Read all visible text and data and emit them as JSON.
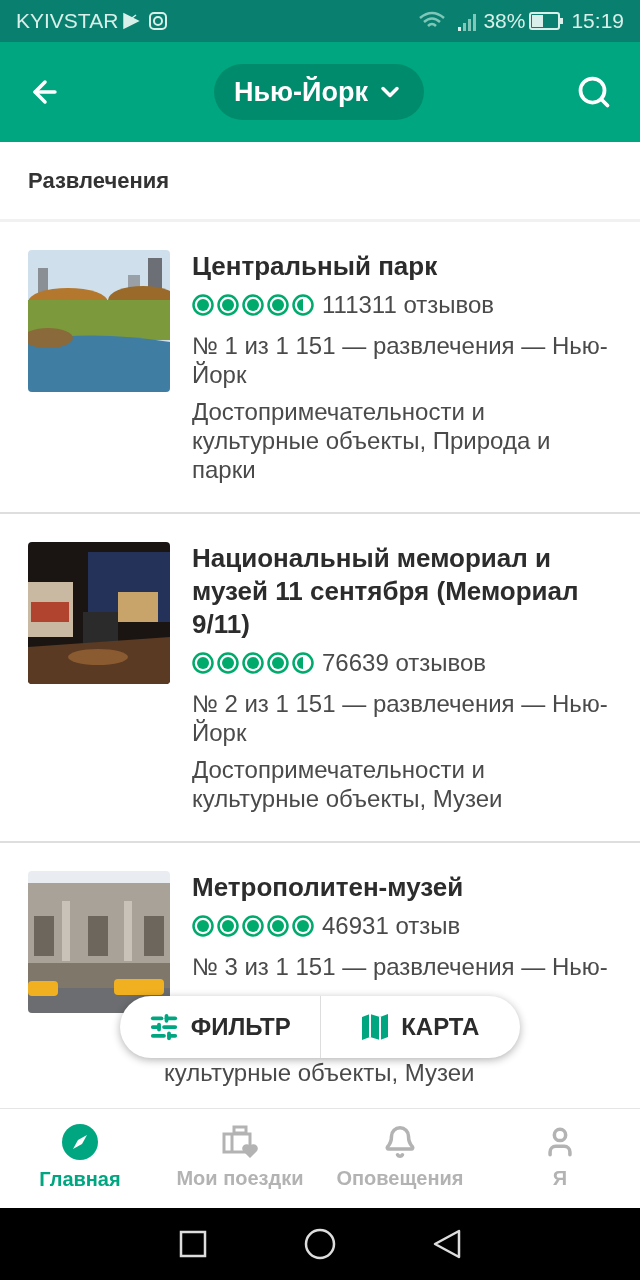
{
  "status_bar": {
    "carrier": "KYIVSTAR",
    "battery": "38%",
    "time": "15:19"
  },
  "header": {
    "city": "Нью-Йорк"
  },
  "section_title": "Развлечения",
  "attractions": [
    {
      "name": "Центральный парк",
      "stars": 4.5,
      "reviews": "111311 отзывов",
      "rank": "№ 1 из 1 151 — развлечения — Нью-Йорк",
      "categories": "Достопримечательности и культурные объекты, Природа и парки"
    },
    {
      "name": "Национальный мемориал и музей 11 сентября (Мемориал 9/11)",
      "stars": 4.5,
      "reviews": "76639 отзывов",
      "rank": "№ 2 из 1 151 — развлечения — Нью-Йорк",
      "categories": "Достопримечательности и культурные объекты, Музеи"
    },
    {
      "name": "Метрополитен-музей",
      "stars": 5,
      "reviews": "46931 отзыв",
      "rank": "№ 3 из 1 151 — развлечения — Нью-",
      "categories": "культурные объекты, Музеи"
    }
  ],
  "floating_actions": [
    {
      "label": "ФИЛЬТР",
      "kind": "filter"
    },
    {
      "label": "КАРТА",
      "kind": "map"
    }
  ],
  "bottom_nav": [
    {
      "label": "Главная",
      "kind": "home",
      "selected": true
    },
    {
      "label": "Мои поездки",
      "kind": "trips",
      "selected": false
    },
    {
      "label": "Оповещения",
      "kind": "alerts",
      "selected": false
    },
    {
      "label": "Я",
      "kind": "me",
      "selected": false
    }
  ]
}
